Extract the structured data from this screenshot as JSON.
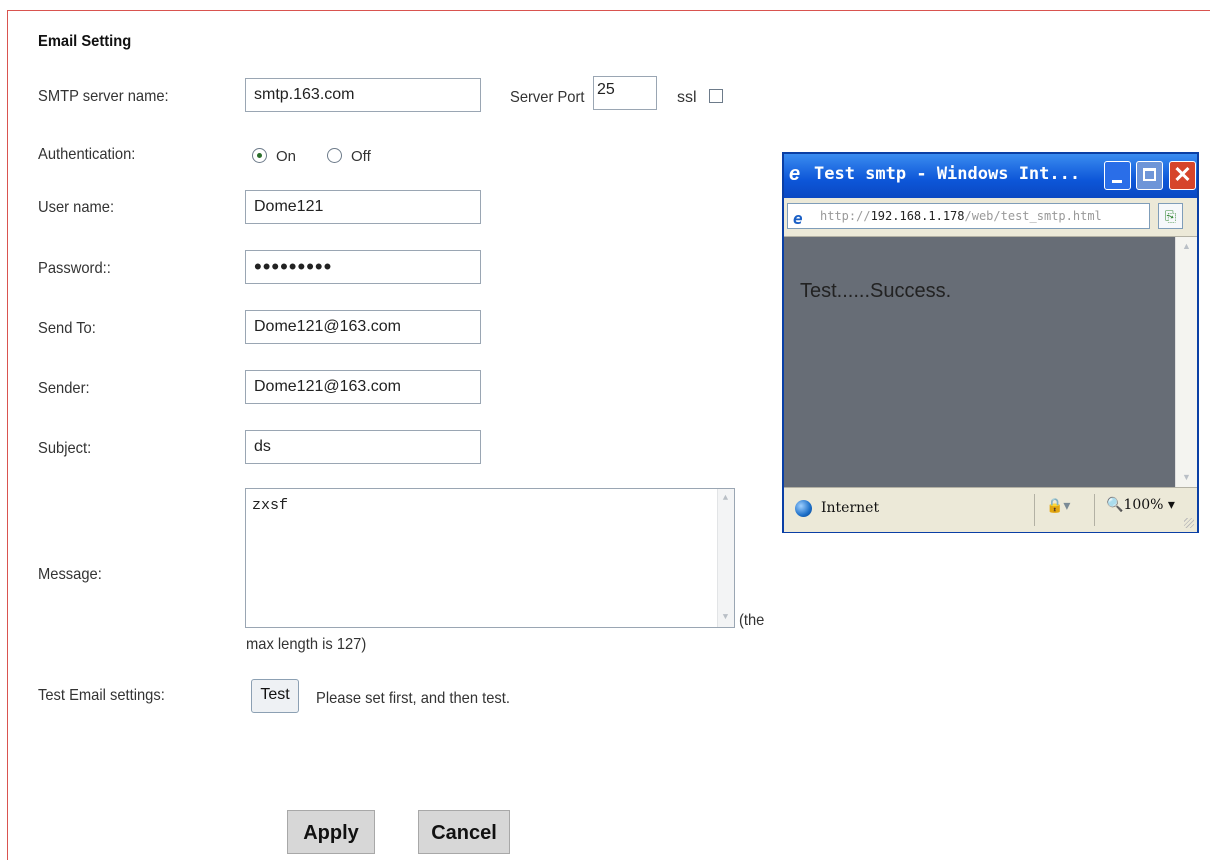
{
  "form": {
    "section_title": "Email Setting",
    "smtp": {
      "label": "SMTP server name:",
      "value": "smtp.163.com"
    },
    "port": {
      "label": "Server Port",
      "value": "25"
    },
    "ssl": {
      "label": "ssl",
      "checked": false
    },
    "auth": {
      "label": "Authentication:",
      "on_label": "On",
      "off_label": "Off",
      "selected": "On"
    },
    "username": {
      "label": "User name:",
      "value": "Dome121"
    },
    "password": {
      "label": "Password::",
      "masked": "•••••••••"
    },
    "send_to": {
      "label": "Send To:",
      "value": "Dome121@163.com"
    },
    "sender": {
      "label": "Sender:",
      "value": "Dome121@163.com"
    },
    "subject": {
      "label": "Subject:",
      "value": "ds"
    },
    "message": {
      "label": "Message:",
      "value": "zxsf",
      "hint_a": "(the",
      "hint_b": "max length is 127)"
    },
    "test": {
      "label": "Test Email settings:",
      "button": "Test",
      "hint": "Please set first, and then test."
    },
    "apply_button": "Apply",
    "cancel_button": "Cancel"
  },
  "popup": {
    "title": "Test smtp - Windows Int...",
    "url_prefix": "http://",
    "url_host": "192.168.1.178",
    "url_path": "/web/test_smtp.html",
    "content": "Test......Success.",
    "status_zone": "Internet",
    "zoom": "100%"
  }
}
